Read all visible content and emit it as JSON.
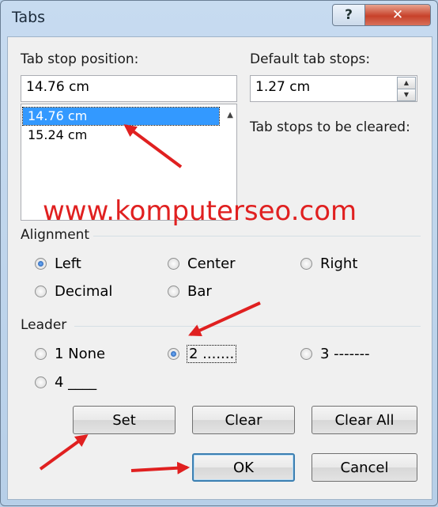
{
  "window": {
    "title": "Tabs",
    "help_label": "?",
    "close_label": "✕"
  },
  "tab_stop_position": {
    "label": "Tab stop position:",
    "value": "14.76 cm",
    "list": [
      "14.76 cm",
      "15.24 cm"
    ]
  },
  "default_tab_stops": {
    "label": "Default tab stops:",
    "value": "1.27 cm"
  },
  "cleared": {
    "label": "Tab stops to be cleared:"
  },
  "watermark": "www.komputerseo.com",
  "alignment": {
    "label": "Alignment",
    "options": [
      "Left",
      "Center",
      "Right",
      "Decimal",
      "Bar"
    ],
    "selected": "Left"
  },
  "leader": {
    "label": "Leader",
    "options": [
      "1 None",
      "2 .......",
      "3 -------",
      "4 ____"
    ],
    "selected": "2 ......."
  },
  "buttons": {
    "set": "Set",
    "clear": "Clear",
    "clear_all": "Clear All",
    "ok": "OK",
    "cancel": "Cancel"
  },
  "colors": {
    "annotation_arrow": "#e02020",
    "selection": "#3399ff"
  }
}
